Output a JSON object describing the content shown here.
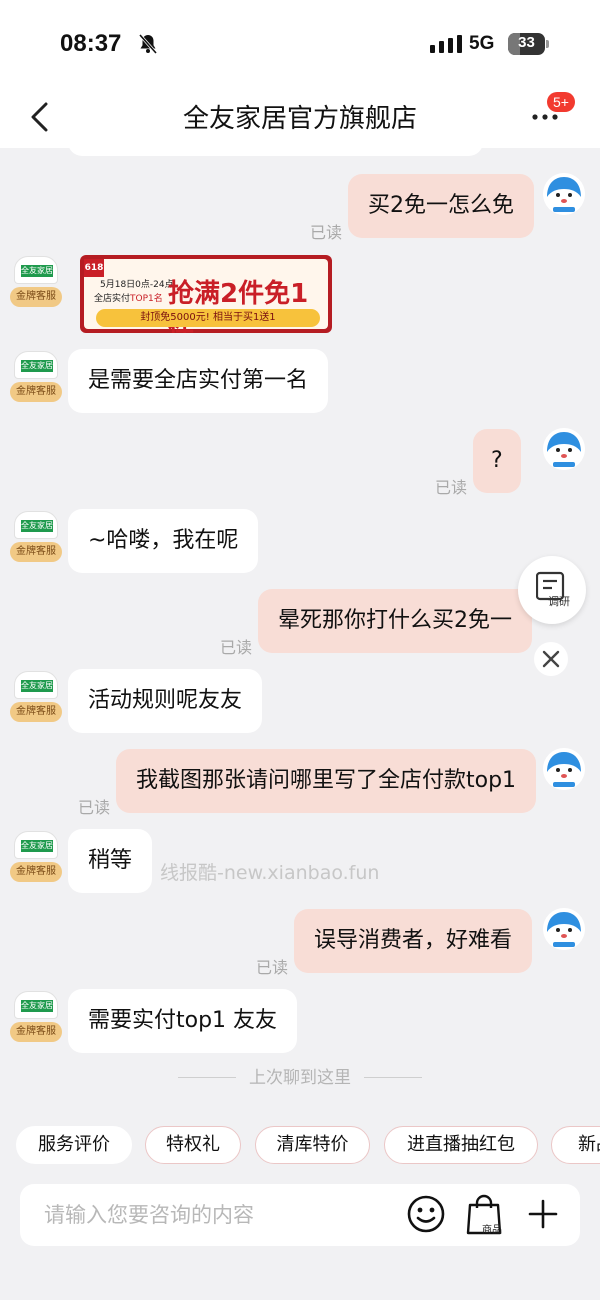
{
  "status_bar": {
    "time": "08:37",
    "network": "5G",
    "battery": "33",
    "battery_level": 0.33
  },
  "nav": {
    "title": "全友家居官方旗舰店",
    "badge": "5+"
  },
  "shop_avatar": {
    "logo_text": "全友家居",
    "tag": "金牌客服"
  },
  "banner": {
    "tag": "618",
    "date": "5月18日0点-24点",
    "top1_prefix": "全店实付",
    "top1_highlight": "TOP1名",
    "headline": "抢满2件免1件",
    "pill": "封顶免5000元! 相当于买1送1"
  },
  "messages": {
    "m1": {
      "text": "买2免一怎么免",
      "read": "已读"
    },
    "m2": {
      "text": "是需要全店实付第一名"
    },
    "m3": {
      "text": "?",
      "read": "已读"
    },
    "m4": {
      "text": "~哈喽，我在呢"
    },
    "m5": {
      "text": "晕死那你打什么买2免一",
      "read": "已读"
    },
    "m6": {
      "text": "活动规则呢友友"
    },
    "m7": {
      "text": "我截图那张请问哪里写了全店付款top1",
      "read": "已读"
    },
    "m8": {
      "text": "稍等"
    },
    "m9": {
      "text": "误导消费者，好难看",
      "read": "已读"
    },
    "m10": {
      "text": "需要实付top1 友友"
    }
  },
  "watermark": "线报酷-new.xianbao.fun",
  "divider": "上次聊到这里",
  "survey_label": "调研",
  "chips": [
    "服务评价",
    "特权礼",
    "清库特价",
    "进直播抽红包",
    "新品"
  ],
  "input": {
    "placeholder": "请输入您要咨询的内容",
    "goods_label": "商品"
  },
  "colors": {
    "bubble_out": "#f8ddd6",
    "badge": "#f23a2f",
    "brand_red": "#b51c22"
  }
}
